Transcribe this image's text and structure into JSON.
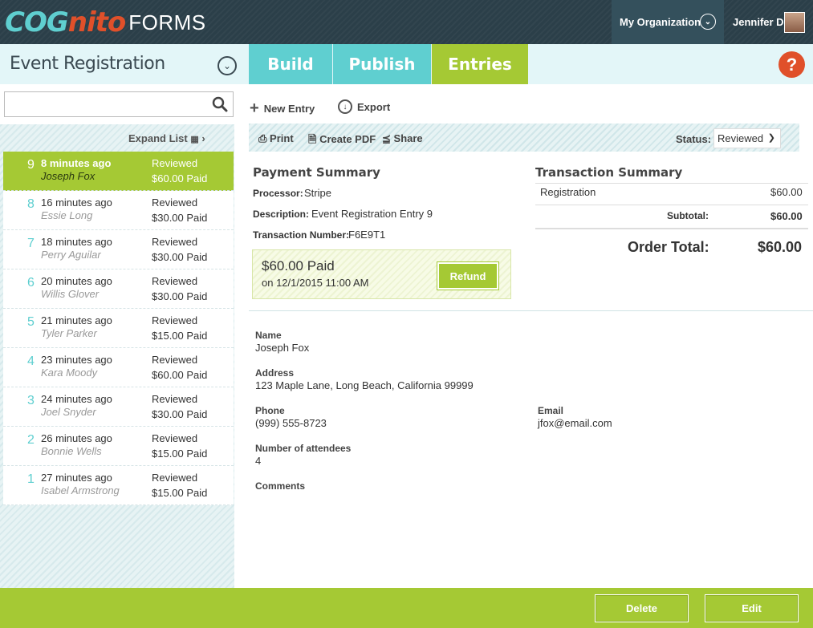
{
  "header": {
    "logo_cog": "COG",
    "logo_nito": "nito",
    "logo_forms": "FORMS",
    "org_label": "My Organization",
    "user_name": "Jennifer D"
  },
  "form": {
    "title": "Event Registration",
    "tabs": {
      "build": "Build",
      "publish": "Publish",
      "entries": "Entries"
    },
    "help": "?"
  },
  "sidebar": {
    "search_value": "",
    "expand_label": "Expand List",
    "entries": [
      {
        "num": "9",
        "when": "8 minutes ago",
        "who": "Joseph Fox",
        "status": "Reviewed",
        "amount": "$60.00 Paid"
      },
      {
        "num": "8",
        "when": "16 minutes ago",
        "who": "Essie Long",
        "status": "Reviewed",
        "amount": "$30.00 Paid"
      },
      {
        "num": "7",
        "when": "18 minutes ago",
        "who": "Perry Aguilar",
        "status": "Reviewed",
        "amount": "$30.00 Paid"
      },
      {
        "num": "6",
        "when": "20 minutes ago",
        "who": "Willis Glover",
        "status": "Reviewed",
        "amount": "$30.00 Paid"
      },
      {
        "num": "5",
        "when": "21 minutes ago",
        "who": "Tyler Parker",
        "status": "Reviewed",
        "amount": "$15.00 Paid"
      },
      {
        "num": "4",
        "when": "23 minutes ago",
        "who": "Kara Moody",
        "status": "Reviewed",
        "amount": "$60.00 Paid"
      },
      {
        "num": "3",
        "when": "24 minutes ago",
        "who": "Joel Snyder",
        "status": "Reviewed",
        "amount": "$30.00 Paid"
      },
      {
        "num": "2",
        "when": "26 minutes ago",
        "who": "Bonnie Wells",
        "status": "Reviewed",
        "amount": "$15.00 Paid"
      },
      {
        "num": "1",
        "when": "27 minutes ago",
        "who": "Isabel Armstrong",
        "status": "Reviewed",
        "amount": "$15.00 Paid"
      }
    ]
  },
  "toolbar": {
    "new_entry": "New Entry",
    "export": "Export",
    "print": "Print",
    "create_pdf": "Create PDF",
    "share": "Share",
    "status_label": "Status:",
    "status_value": "Reviewed"
  },
  "payment": {
    "title": "Payment Summary",
    "processor_label": "Processor:",
    "processor": "Stripe",
    "description_label": "Description:",
    "description": "Event Registration Entry 9",
    "txn_label": "Transaction Number:",
    "txn": "F6E9T1",
    "paid_amount": "$60.00 Paid",
    "paid_on": "on 12/1/2015 11:00 AM",
    "refund": "Refund"
  },
  "transaction": {
    "title": "Transaction Summary",
    "item_label": "Registration",
    "item_amount": "$60.00",
    "subtotal_label": "Subtotal:",
    "subtotal": "$60.00",
    "total_label": "Order Total:",
    "total": "$60.00"
  },
  "fields": {
    "name_label": "Name",
    "name": "Joseph Fox",
    "address_label": "Address",
    "address": "123 Maple Lane, Long Beach, California 99999",
    "phone_label": "Phone",
    "phone": "(999) 555-8723",
    "email_label": "Email",
    "email": "jfox@email.com",
    "attendees_label": "Number of attendees",
    "attendees": "4",
    "comments_label": "Comments"
  },
  "footer": {
    "delete": "Delete",
    "edit": "Edit"
  },
  "colors": {
    "green": "#a5c934",
    "teal": "#5fcfd0",
    "navy": "#2b3f49",
    "help": "#e0502a"
  }
}
